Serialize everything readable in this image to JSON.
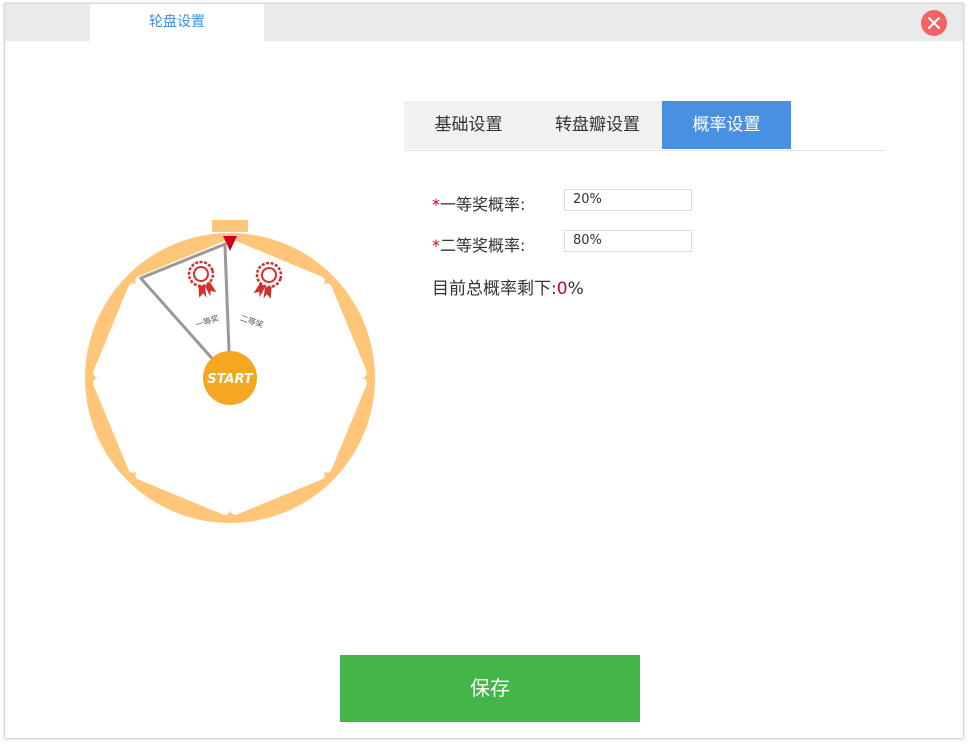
{
  "window": {
    "tab_title": "轮盘设置"
  },
  "tabs": [
    {
      "label": "基础设置",
      "active": false
    },
    {
      "label": "转盘瓣设置",
      "active": false
    },
    {
      "label": "概率设置",
      "active": true
    }
  ],
  "form": {
    "required_mark": "*",
    "first_prize": {
      "label": "一等奖概率:",
      "value": "20%"
    },
    "second_prize": {
      "label": "二等奖概率:",
      "value": "80%"
    },
    "remaining": {
      "label": "目前总概率剩下:",
      "value": "0",
      "unit": "%"
    }
  },
  "wheel": {
    "start_label": "START",
    "prizes": [
      "一等奖",
      "二等奖"
    ]
  },
  "actions": {
    "save_label": "保存"
  },
  "colors": {
    "accent": "#4a90e2",
    "save": "#44b549",
    "close": "#f26363",
    "wheel_ring": "#ffc679",
    "start": "#f5a623",
    "pointer": "#d0021b"
  }
}
